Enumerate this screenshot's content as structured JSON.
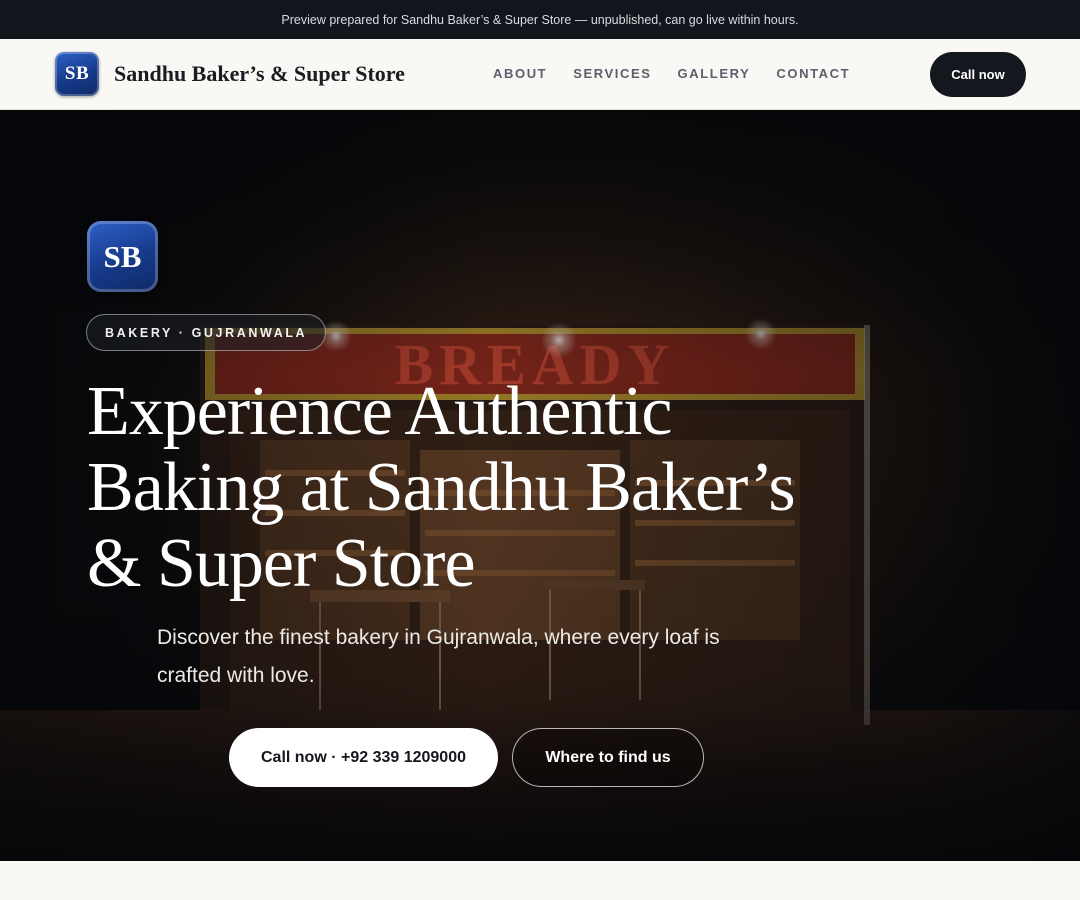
{
  "preview_banner": "Preview prepared for Sandhu Baker’s & Super Store — unpublished, can go live within hours.",
  "header": {
    "logo_text": "SB",
    "brand_name": "Sandhu Baker’s & Super Store",
    "nav": [
      {
        "label": "ABOUT"
      },
      {
        "label": "SERVICES"
      },
      {
        "label": "GALLERY"
      },
      {
        "label": "CONTACT"
      }
    ],
    "call_button": "Call now"
  },
  "hero": {
    "logo_text": "SB",
    "tag": "BAKERY · GUJRANWALA",
    "title": "Experience Authentic Baking at Sandhu Baker’s & Super Store",
    "subtitle": "Discover the finest bakery in Gujranwala, where every loaf is crafted with love.",
    "primary_button": "Call now · +92 339 1209000",
    "secondary_button": "Where to find us",
    "background_sign": "BREADY"
  },
  "colors": {
    "dark": "#14171e",
    "brand_blue": "#1e4aa8",
    "cream": "#faf8f4",
    "sign_red": "#9c2a1e"
  }
}
